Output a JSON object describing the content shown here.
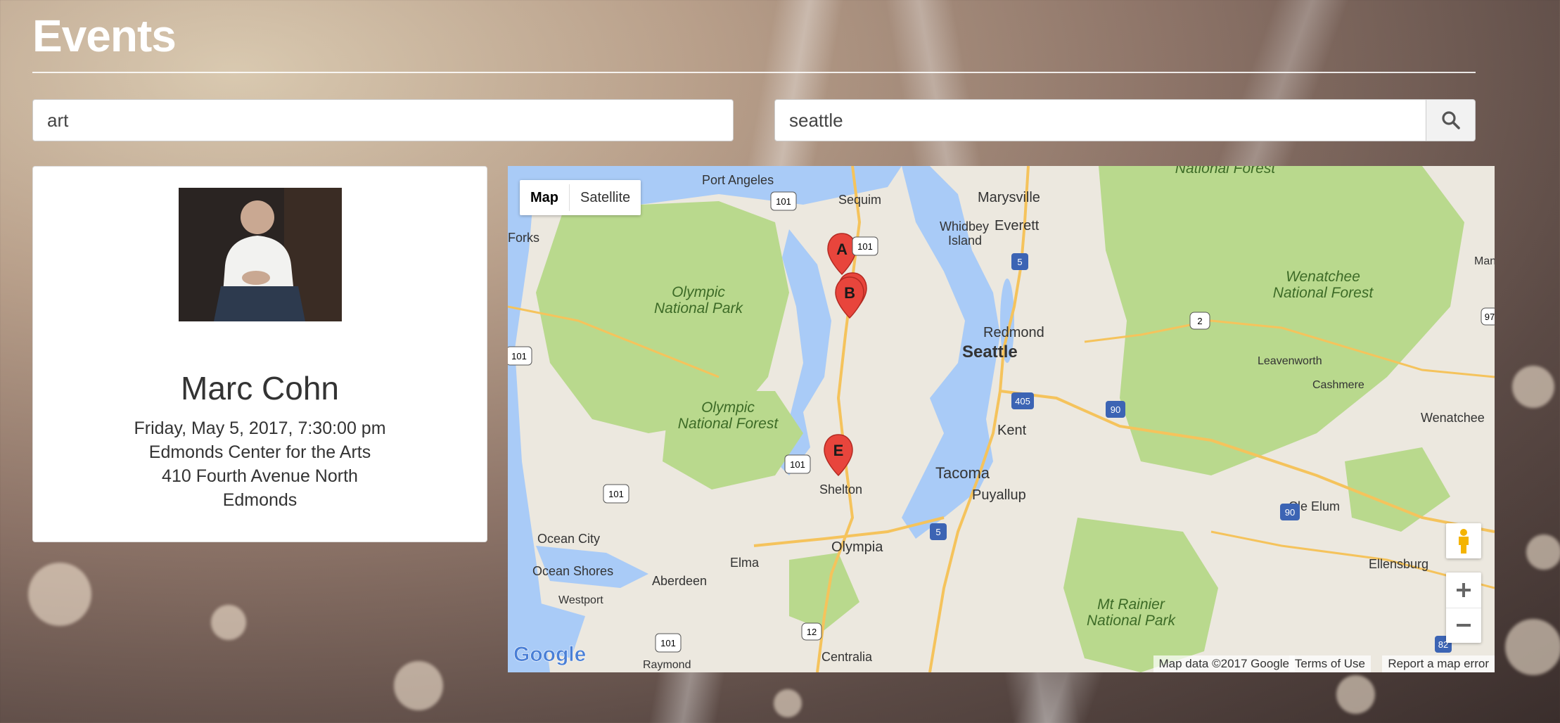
{
  "page": {
    "title": "Events"
  },
  "search": {
    "query_value": "art",
    "location_value": "seattle",
    "button_icon": "search-icon"
  },
  "event": {
    "name": "Marc Cohn",
    "datetime": "Friday, May 5, 2017, 7:30:00 pm",
    "venue": "Edmonds Center for the Arts",
    "address": "410 Fourth Avenue North",
    "city": "Edmonds"
  },
  "map": {
    "view_tabs": {
      "map": "Map",
      "satellite": "Satellite"
    },
    "places": {
      "port_angeles": "Port Angeles",
      "sequim": "Sequim",
      "forks": "Forks",
      "whidbey": "Whidbey",
      "island": "Island",
      "marysville": "Marysville",
      "everett": "Everett",
      "redmond": "Redmond",
      "seattle": "Seattle",
      "kent": "Kent",
      "tacoma": "Tacoma",
      "puyallup": "Puyallup",
      "olympia": "Olympia",
      "shelton": "Shelton",
      "elma": "Elma",
      "aberdeen": "Aberdeen",
      "ocean_city": "Ocean City",
      "ocean_shores": "Ocean Shores",
      "westport": "Westport",
      "raymond": "Raymond",
      "centralia": "Centralia",
      "leavenworth": "Leavenworth",
      "cashmere": "Cashmere",
      "wenatchee": "Wenatchee",
      "cle_elum": "Cle Elum",
      "ellensburg": "Ellensburg",
      "man": "Man"
    },
    "parks": {
      "onp1": "Olympic",
      "onp2": "National Park",
      "onf1": "Olympic",
      "onf2": "National Forest",
      "wnf1": "Wenatchee",
      "wnf2": "National Forest",
      "mrnp1": "Mt Rainier",
      "mrnp2": "National Park",
      "nf_top": "National Forest"
    },
    "shields": [
      "101",
      "101",
      "101",
      "101",
      "101",
      "101",
      "5",
      "5",
      "405",
      "90",
      "90",
      "2",
      "12",
      "82",
      "97"
    ],
    "markers": [
      "A",
      "B",
      "E"
    ],
    "footer": {
      "logo": "Google",
      "attribution": "Map data ©2017 Google",
      "terms": "Terms of Use",
      "report": "Report a map error"
    },
    "colors": {
      "water": "#a9cbf7",
      "forest": "#b9d98d",
      "land": "#ece8df",
      "marker": "#e8453c"
    }
  }
}
